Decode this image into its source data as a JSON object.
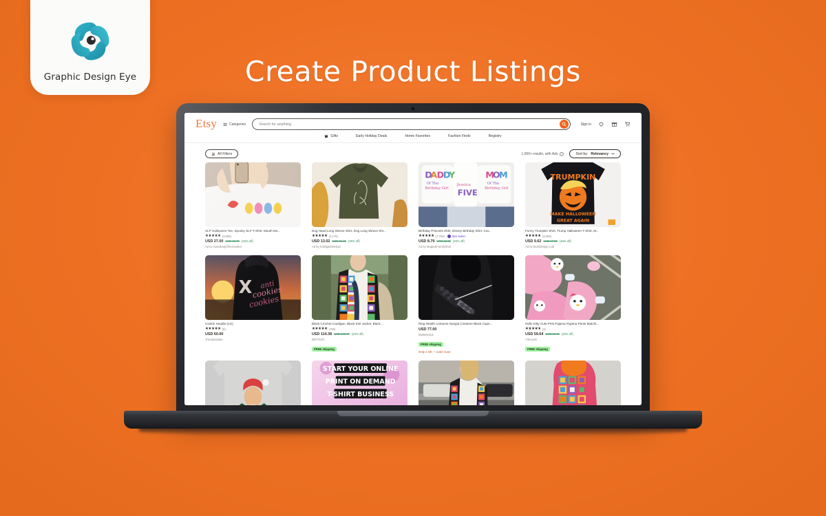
{
  "brand": {
    "logo_text": "Graphic Design Eye",
    "logo_icon": "eye-pinwheel-logo",
    "accent_color": "#2aa3b8"
  },
  "headline": "Create Product Listings",
  "background_color": "#ee7023",
  "device": "laptop-mockup",
  "site": {
    "logo": "Etsy",
    "categories_label": "Categories",
    "search": {
      "placeholder": "Search for anything",
      "value": "",
      "button_icon": "search-icon",
      "button_color": "#f1641e"
    },
    "account": {
      "sign_in_label": "Sign in",
      "icons": [
        "heart-icon",
        "gift-icon",
        "cart-icon"
      ]
    },
    "nav": [
      {
        "label": "Gifts",
        "icon": "gift-icon"
      },
      {
        "label": "Early Holiday Deals",
        "icon": ""
      },
      {
        "label": "Home Favorites",
        "icon": ""
      },
      {
        "label": "Fashion Finds",
        "icon": ""
      },
      {
        "label": "Registry",
        "icon": ""
      }
    ],
    "filterbar": {
      "all_filters_label": "All Filters",
      "all_filters_icon": "filter-icon",
      "results_text": "1,000+ results, with Ads",
      "info_icon": "info-icon",
      "sort_prefix": "Sort by:",
      "sort_value": "Relevancy",
      "sort_caret": "chevron-down-icon"
    },
    "products": [
      {
        "title": "SLP Halloween Tee, Spooky SLP T-Shirt, Mouth Mo...",
        "stars": "★★★★★",
        "review_count": "(3,686)",
        "price": "USD 27.00",
        "price_old": "USD 36.00",
        "discount": "(25% off)",
        "seller": "Ad by SpeakingOfSemantics",
        "badge": "",
        "low_stock": "",
        "star_seller": false,
        "image": "white-tee-ghosts-phone-selfie"
      },
      {
        "title": "Dog Hand Long Sleeve Shirt, Dog Long Sleeve Shi...",
        "stars": "★★★★★",
        "review_count": "(1,176)",
        "price": "USD 13.02",
        "price_old": "USD 21.41",
        "discount": "(35% off)",
        "seller": "Ad by KraftgateDesign",
        "badge": "",
        "low_stock": "",
        "star_seller": false,
        "image": "olive-green-longsleeve-dog-hand"
      },
      {
        "title": "Birthday Princess Shirt, Disney Birthday Shirt, Cra...",
        "stars": "★★★★★",
        "review_count": "(7,754)",
        "price": "USD 8.79",
        "price_old": "USD 10.99",
        "discount": "(20% off)",
        "seller": "Ad by MagicalFamilyShirt",
        "badge": "",
        "low_stock": "",
        "star_seller": true,
        "star_seller_label": "Star Seller",
        "image": "birthday-princess-white-shirts"
      },
      {
        "title": "Funny Trumpkin Shirt, Trump Halloween T-Shirt, M...",
        "stars": "★★★★★",
        "review_count": "(3,608)",
        "price": "USD 9.62",
        "price_old": "USD 17.86",
        "discount": "(46% off)",
        "seller": "Ad by BUDDesign-Lab",
        "badge": "",
        "low_stock": "",
        "star_seller": false,
        "image": "black-tee-trumpkin-pumpkin"
      },
      {
        "title": "Cookie Hoodie (LG)",
        "stars": "★★★★★",
        "review_count": "(6)",
        "price": "USD 60.00",
        "price_old": "",
        "discount": "",
        "seller": "TrendySookie",
        "badge": "",
        "low_stock": "",
        "star_seller": false,
        "image": "black-hoodie-sunset-back"
      },
      {
        "title": "Black Crochet Cardigan, Black Knit Jacket, Black ...",
        "stars": "★★★★★",
        "review_count": "(780)",
        "price": "USD 114.38",
        "price_old": "USD 142.97",
        "discount": "(20% off)",
        "seller": "BfsTTechi",
        "badge": "FREE shipping",
        "low_stock": "",
        "star_seller": false,
        "image": "granny-square-crochet-cardigan-model"
      },
      {
        "title": "Ring Wraith Costume Nazgul Costume Black Cape...",
        "stars": "",
        "review_count": "",
        "price": "USD 77.00",
        "price_old": "",
        "discount": "",
        "seller": "MakeItsoUL",
        "badge": "FREE shipping",
        "low_stock": "Only 2 left — order soon",
        "star_seller": false,
        "image": "black-ringwraith-costume-dagger"
      },
      {
        "title": "Hello Kitty Cute Pink Pajama Pyjama Pants Matchi...",
        "stars": "★★★★★",
        "review_count": "(3)",
        "price": "USD 59.64",
        "price_old": "USD 84.96",
        "discount": "(25% off)",
        "seller": "Y2Kcueh",
        "badge": "FREE shipping",
        "low_stock": "",
        "star_seller": false,
        "image": "pink-hello-kitty-pajama-pants"
      },
      {
        "title": "",
        "stars": "",
        "review_count": "",
        "price": "",
        "price_old": "",
        "discount": "",
        "seller": "",
        "badge": "",
        "low_stock": "",
        "star_seller": false,
        "image": "grey-tee-santa-trump-christmas"
      },
      {
        "title": "",
        "stars": "",
        "review_count": "",
        "price": "",
        "price_old": "",
        "discount": "",
        "seller": "",
        "badge": "",
        "low_stock": "",
        "star_seller": false,
        "image": "print-on-demand-tshirt-business-banner",
        "banner_lines": [
          "START YOUR ONLINE",
          "PRINT ON DEMAND",
          "T-SHIRT BUSINESS"
        ]
      },
      {
        "title": "",
        "stars": "",
        "review_count": "",
        "price": "",
        "price_old": "",
        "discount": "",
        "seller": "",
        "badge": "",
        "low_stock": "",
        "star_seller": false,
        "image": "colorful-crochet-cardigan-street"
      },
      {
        "title": "",
        "stars": "",
        "review_count": "",
        "price": "",
        "price_old": "",
        "discount": "",
        "seller": "",
        "badge": "",
        "low_stock": "",
        "star_seller": false,
        "image": "rainbow-crochet-hooded-cardigan"
      }
    ]
  }
}
